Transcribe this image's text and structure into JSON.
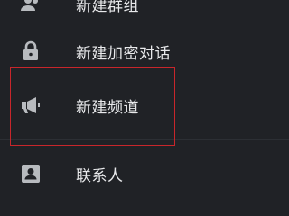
{
  "menu": {
    "items": [
      {
        "label": "新建群组",
        "icon": "group-icon"
      },
      {
        "label": "新建加密对话",
        "icon": "lock-icon"
      },
      {
        "label": "新建频道",
        "icon": "megaphone-icon"
      },
      {
        "label": "联系人",
        "icon": "contact-icon"
      }
    ]
  },
  "colors": {
    "background": "#202226",
    "text": "#e8e9eb",
    "icon": "#b8bbbf",
    "highlight_border": "#c8262b"
  }
}
